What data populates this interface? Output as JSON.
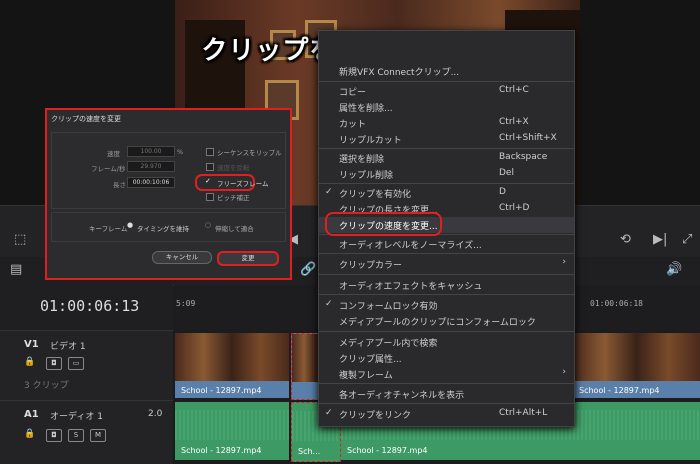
{
  "overlay_title": "クリップを静止画にする",
  "timecode": "01:00:06:13",
  "ruler": {
    "labels": [
      "5:09",
      "01:00:06:18"
    ]
  },
  "tracks": {
    "video": {
      "id": "V1",
      "name": "ビデオ 1",
      "clip_count": "3 クリップ"
    },
    "audio": {
      "id": "A1",
      "name": "オーディオ 1",
      "level": "2.0",
      "btn_s": "S",
      "btn_m": "M"
    }
  },
  "clips": {
    "video": [
      "School - 12897.mp4",
      "School - 12897.mp4"
    ],
    "audio": [
      "School - 12897.mp4",
      "Sch...",
      "School - 12897.mp4"
    ]
  },
  "menu": {
    "items": [
      {
        "label": "新規VFX Connectクリップ...",
        "key": ""
      },
      {
        "label": "コピー",
        "key": "Ctrl+C"
      },
      {
        "label": "属性を削除...",
        "key": ""
      },
      {
        "label": "カット",
        "key": "Ctrl+X"
      },
      {
        "label": "リップルカット",
        "key": "Ctrl+Shift+X"
      },
      {
        "label": "選択を削除",
        "key": "Backspace"
      },
      {
        "label": "リップル削除",
        "key": "Del"
      },
      {
        "label": "クリップを有効化",
        "key": "D"
      },
      {
        "label": "クリップの長さを変更...",
        "key": "Ctrl+D"
      },
      {
        "label": "クリップの速度を変更...",
        "key": ""
      },
      {
        "label": "オーディオレベルをノーマライズ...",
        "key": ""
      },
      {
        "label": "クリップカラー",
        "key": ""
      },
      {
        "label": "オーディオエフェクトをキャッシュ",
        "key": ""
      },
      {
        "label": "コンフォームロック有効",
        "key": ""
      },
      {
        "label": "メディアプールのクリップにコンフォームロック",
        "key": ""
      },
      {
        "label": "メディアプール内で検索",
        "key": ""
      },
      {
        "label": "クリップ属性...",
        "key": ""
      },
      {
        "label": "複製フレーム",
        "key": ""
      },
      {
        "label": "各オーディオチャンネルを表示",
        "key": ""
      },
      {
        "label": "クリップをリンク",
        "key": "Ctrl+Alt+L"
      }
    ]
  },
  "dialog": {
    "title": "クリップの速度を変更",
    "speed_label": "速度",
    "speed_value": "100.00",
    "speed_unit": "%",
    "fps_label": "フレーム/秒",
    "fps_value": "29.970",
    "duration_label": "長さ",
    "duration_value": "00:00:10:06",
    "opt_ripple": "シーケンスをリップル",
    "opt_reverse": "速度を反転",
    "opt_freeze": "フリーズフレーム",
    "opt_pitch": "ピッチ補正",
    "keyframe_label": "キーフレーム",
    "kf_opt1": "タイミングを維持",
    "kf_opt2": "伸縮して適合",
    "cancel": "キャンセル",
    "apply": "変更"
  },
  "colors": {
    "highlight": "#e02020",
    "video_clip": "#5a7fa8",
    "audio_clip": "#3d9a64"
  }
}
